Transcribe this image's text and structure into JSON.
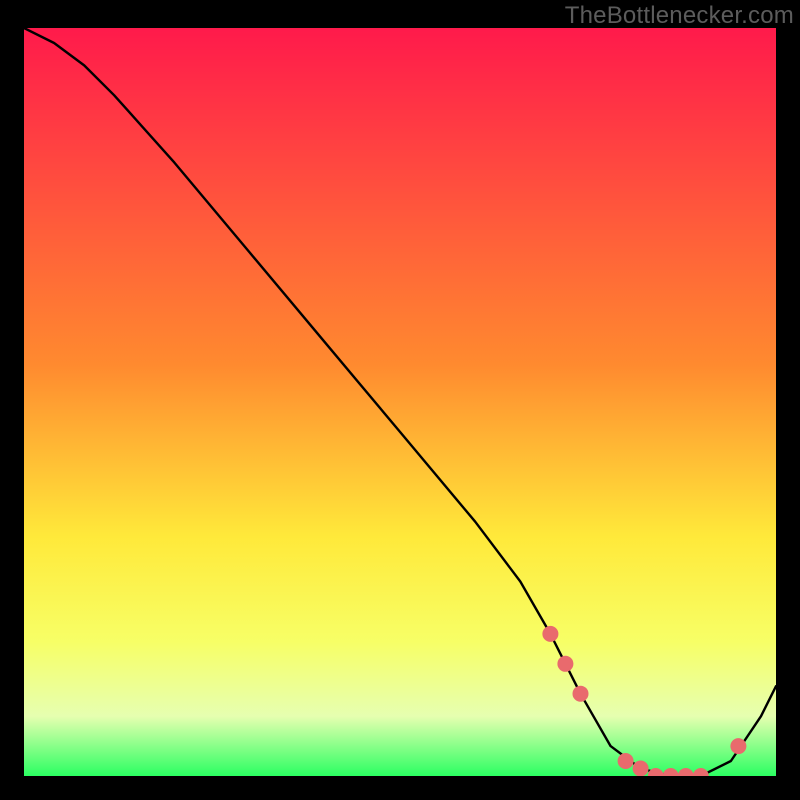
{
  "watermark": "TheBottlenecker.com",
  "colors": {
    "frame_bg": "#000000",
    "curve": "#000000",
    "marker": "#e96a6d",
    "grad_top": "#ff1a4b",
    "grad_mid_upper": "#ff8a2f",
    "grad_mid": "#ffe93a",
    "grad_lower": "#f7ff66",
    "grad_pale": "#e6ffb0",
    "grad_green": "#2bff62"
  },
  "chart_data": {
    "type": "line",
    "title": "",
    "xlabel": "",
    "ylabel": "",
    "xlim": [
      0,
      100
    ],
    "ylim": [
      0,
      100
    ],
    "series": [
      {
        "name": "bottleneck-curve",
        "x": [
          0,
          4,
          8,
          12,
          20,
          30,
          40,
          50,
          60,
          66,
          70,
          74,
          78,
          82,
          86,
          90,
          94,
          98,
          100
        ],
        "y": [
          100,
          98,
          95,
          91,
          82,
          70,
          58,
          46,
          34,
          26,
          19,
          11,
          4,
          1,
          0,
          0,
          2,
          8,
          12
        ]
      }
    ],
    "markers": {
      "name": "highlighted-points",
      "x": [
        70,
        72,
        74,
        80,
        82,
        84,
        86,
        88,
        90,
        95
      ],
      "y": [
        19,
        15,
        11,
        2,
        1,
        0,
        0,
        0,
        0,
        4
      ]
    },
    "gradient_stops_pct": [
      {
        "offset": 0,
        "key": "grad_top"
      },
      {
        "offset": 45,
        "key": "grad_mid_upper"
      },
      {
        "offset": 68,
        "key": "grad_mid"
      },
      {
        "offset": 82,
        "key": "grad_lower"
      },
      {
        "offset": 92,
        "key": "grad_pale"
      },
      {
        "offset": 100,
        "key": "grad_green"
      }
    ]
  }
}
